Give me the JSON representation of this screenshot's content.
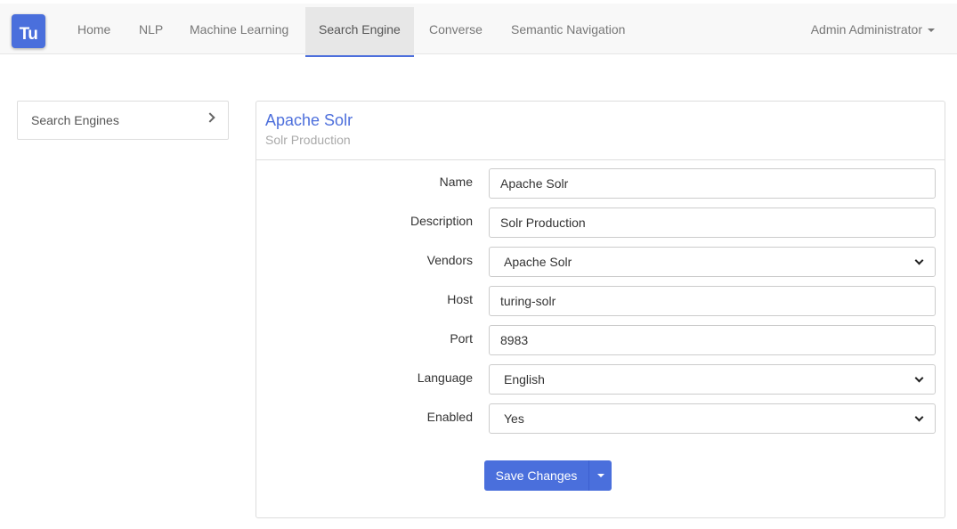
{
  "app": {
    "logo_text": "Tu",
    "brand_color": "#4a6fdc"
  },
  "nav": {
    "items": [
      {
        "label": "Home"
      },
      {
        "label": "NLP"
      },
      {
        "label": "Machine Learning"
      },
      {
        "label": "Search Engine",
        "active": true
      },
      {
        "label": "Converse"
      },
      {
        "label": "Semantic Navigation"
      }
    ],
    "user": "Admin Administrator"
  },
  "sidebar": {
    "items": [
      {
        "label": "Search Engines",
        "icon": "chevron-right-icon"
      }
    ]
  },
  "panel": {
    "title": "Apache Solr",
    "subtitle": "Solr Production"
  },
  "form": {
    "name": {
      "label": "Name",
      "value": "Apache Solr"
    },
    "description": {
      "label": "Description",
      "value": "Solr Production"
    },
    "vendors": {
      "label": "Vendors",
      "value": "Apache Solr"
    },
    "host": {
      "label": "Host",
      "value": "turing-solr"
    },
    "port": {
      "label": "Port",
      "value": "8983"
    },
    "language": {
      "label": "Language",
      "value": "English"
    },
    "enabled": {
      "label": "Enabled",
      "value": "Yes"
    },
    "save_label": "Save Changes"
  }
}
